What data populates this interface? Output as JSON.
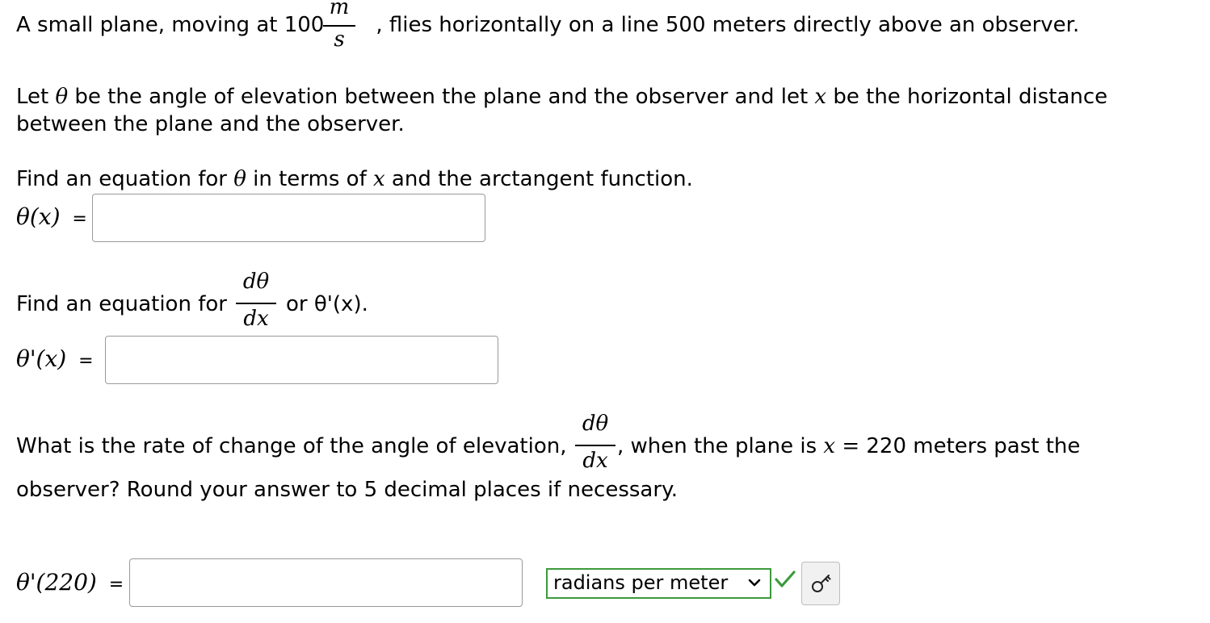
{
  "q1": {
    "prefix": "A small plane, moving at 100",
    "unit_numerator": "m",
    "unit_denominator": "s",
    "suffix": ", flies horizontally on a line 500 meters directly above an observer."
  },
  "q2": {
    "line1_a": "Let ",
    "line1_b": " be the angle of elevation between the plane and the observer and let ",
    "line1_c": " be the horizontal distance",
    "line2": "between the plane and the observer.",
    "theta": "θ",
    "x": "x"
  },
  "part1": {
    "instr_a": "Find an equation for ",
    "instr_b": " in terms of ",
    "instr_c": " and the arctangent function.",
    "label": "θ(x)",
    "equals": "=",
    "answer_value": ""
  },
  "part2": {
    "instr_a": "Find an equation for",
    "frac_num": "dθ",
    "frac_den": "dx",
    "instr_b": "or θ'(x).",
    "label": "θ'(x)",
    "equals": "=",
    "answer_value": ""
  },
  "part3": {
    "text_a": "What is the rate of change of the angle of elevation,",
    "frac_num": "dθ",
    "frac_den": "dx",
    "comma": ",",
    "text_b": " when the plane is ",
    "x_eq": "x",
    "eq_sign": " = ",
    "text_c": "220 meters past the",
    "line2": "observer? Round your answer to 5 decimal places if necessary.",
    "label": "θ'(220)",
    "equals": "=",
    "answer_value": "",
    "unit_selected": "radians per meter"
  },
  "colors": {
    "check": "#3c9a3c",
    "select_border": "#3c9a3c",
    "box_border": "#9a9a9a"
  },
  "icons": {
    "status": "check-icon",
    "key": "key-icon",
    "dropdown": "chevron-down-icon"
  }
}
